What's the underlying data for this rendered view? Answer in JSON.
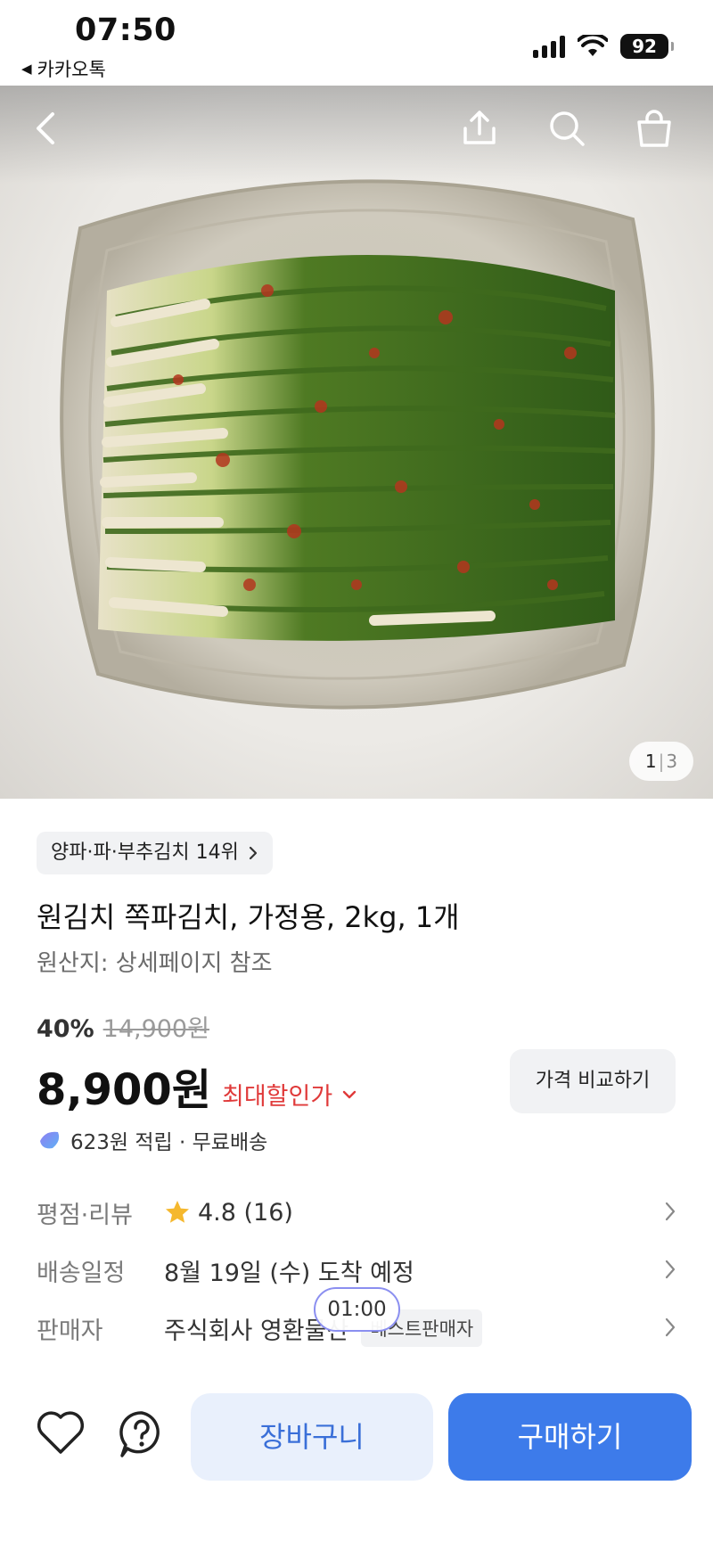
{
  "status_bar": {
    "time": "07:50",
    "back_app": "카카오톡",
    "battery": "92"
  },
  "hero": {
    "image_index": "1",
    "image_total": "3"
  },
  "product": {
    "rank_chip": "양파·파·부추김치 14위",
    "title": "원김치 쪽파김치, 가정용, 2kg, 1개",
    "origin": "원산지: 상세페이지 참조",
    "discount_percent": "40%",
    "original_price": "14,900원",
    "price": "8,900원",
    "max_discount_label": "최대할인가",
    "compare_button": "가격 비교하기",
    "points_text": "623원 적립 · 무료배송"
  },
  "info": {
    "rating_label": "평점·리뷰",
    "rating_value": "4.8 (16)",
    "delivery_label": "배송일정",
    "delivery_value": "8월 19일 (수) 도착 예정",
    "seller_label": "판매자",
    "seller_value": "주식회사 영환물산",
    "seller_badge": "베스트판매자",
    "timer": "01:00"
  },
  "bottom_bar": {
    "cart_button": "장바구니",
    "buy_button": "구매하기"
  },
  "colors": {
    "accent": "#3d7bea",
    "accent_light": "#e9f0fc",
    "sale_red": "#e03a3a",
    "star": "#f5b82e"
  },
  "icons": [
    "back-arrow-icon",
    "share-icon",
    "search-icon",
    "shopping-bag-icon",
    "chevron-right-icon",
    "chevron-down-icon",
    "star-icon",
    "points-icon",
    "heart-icon",
    "help-icon"
  ]
}
